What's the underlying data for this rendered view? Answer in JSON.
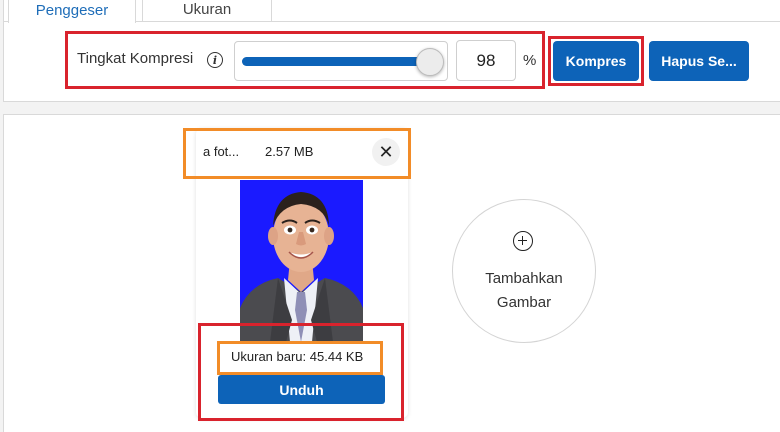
{
  "tabs": [
    {
      "label": "Penggeser",
      "active": true
    },
    {
      "label": "Ukuran",
      "active": false
    }
  ],
  "compress": {
    "label": "Tingkat Kompresi",
    "info_icon": "info-icon",
    "slider_value": 98,
    "input_value": "98",
    "unit": "%"
  },
  "buttons": {
    "compress": "Kompres",
    "clear": "Hapus Se..."
  },
  "file": {
    "name": "a fot...",
    "size": "2.57 MB",
    "new_size": "Ukuran baru: 45.44 KB",
    "download": "Unduh",
    "close_icon": "close-icon"
  },
  "add_image": {
    "icon": "plus-circle-icon",
    "label_line1": "Tambahkan",
    "label_line2": "Gambar"
  },
  "colors": {
    "accent": "#0d63b8",
    "highlight_red": "#d9232d",
    "highlight_orange": "#f28c28",
    "photo_background": "#1a1aff"
  }
}
